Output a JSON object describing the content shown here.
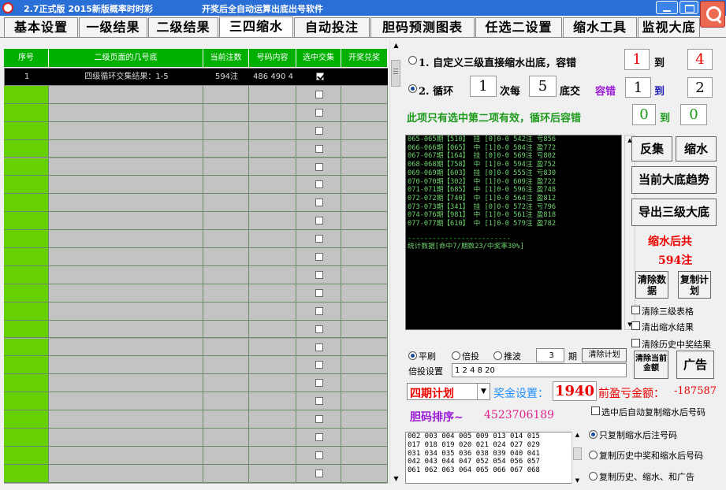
{
  "window": {
    "version": "2.7正式版 2015新版概率时时彩",
    "subtitle": "开奖后全自动运算出底出号软件"
  },
  "tabs": [
    "基本设置",
    "一级结果",
    "二级结果",
    "三四缩水",
    "自动投注",
    "胆码预测图表",
    "任选二设置",
    "缩水工具",
    "监视大底"
  ],
  "active_tab": "三四缩水",
  "grid": {
    "columns": [
      "序号",
      "二级页面的几号底",
      "当前注数",
      "号码内容",
      "选中交集",
      "开奖兑奖"
    ],
    "selected_row": {
      "index": "1",
      "name": "四级循环交集结果：1-5",
      "count": "594注",
      "numbers": "486 490 4",
      "checked": true
    },
    "empty_rows": 22
  },
  "options": {
    "opt1_label": "1. 自定义三级直接缩水出底，容错",
    "opt1_from": "1",
    "opt1_to_label": "到",
    "opt1_to": "4",
    "opt2_label": "2. 循环",
    "opt2_times": "1",
    "opt2_every_label": "次每",
    "opt2_every": "5",
    "opt2_unit_label": "底交",
    "opt2_tol_label": "容错",
    "opt2_from": "1",
    "opt2_to_label": "到",
    "opt2_to": "2",
    "note": "此项只有选中第二项有效，循环后容错",
    "note_from": "0",
    "note_to_label": "到",
    "note_to": "0"
  },
  "console": {
    "lines": [
      "065-065期【510】 挂 [0]0-0 542注 亏856",
      "066-066期【065】 中 [1]0-0 584注 盈772",
      "067-067期【164】 挂 [0]0-0 569注 亏802",
      "068-068期【758】 中 [1]0-0 594注 盈752",
      "069-069期【603】 挂 [0]0-0 555注 亏830",
      "070-070期【302】 中 [1]0-0 609注 盈722",
      "071-071期【685】 中 [1]0-0 596注 盈748",
      "072-072期【740】 中 [1]0-0 564注 盈812",
      "073-073期【341】 挂 [0]0-0 572注 亏796",
      "074-076期【981】 中 [1]0-0 561注 盈818",
      "077-077期【610】 中 [1]0-0 579注 盈782"
    ],
    "separator": "-------------------------",
    "stats": "统计数据[命中7/期数23/中奖率30%]"
  },
  "buttons": {
    "invert": "反集",
    "shrink": "缩水",
    "trend": "当前大底趋势",
    "export": "导出三级大底",
    "clear_data": "清除数据",
    "copy_plan": "复制计划",
    "clear_amount": "清除当前金额",
    "ads": "广告",
    "clear_plan": "清除计划"
  },
  "result": {
    "label": "缩水后共",
    "count": "594注"
  },
  "checks": {
    "clear_table": "清除三级表格",
    "clear_result": "清出缩水结果",
    "clear_history": "清除历史中奖结果",
    "auto_copy": "选中后自动复制缩水后号码"
  },
  "betting": {
    "mode_flat": "平刷",
    "mode_multiple": "倍投",
    "mode_push": "推波",
    "periods_value": "3",
    "periods_label": "期",
    "multiple_label": "倍投设置",
    "multiple_value": "1 2 4 8 20"
  },
  "plan": {
    "selected": "四期计划",
    "prize_label": "奖金设置：",
    "prize_value": "1940",
    "profit_label": "前盈亏金额：",
    "profit_value": "-187587"
  },
  "dan": {
    "label": "胆码排序~",
    "value": "4523706189"
  },
  "numbers_list": [
    "002 003 004 005 009 013 014 015",
    "017 018 019 020 021 024 027 029",
    "031 034 035 036 038 039 040 041",
    "042 043 044 047 052 054 056 057",
    "061 062 063 064 065 066 067 068"
  ],
  "copy_modes": {
    "only_shrunk": "只复制缩水后注号码",
    "history_and_shrunk": "复制历史中奖和缩水后号码",
    "history_shrunk_ads": "复制历史、缩水、和广告"
  },
  "colors": {
    "grid_header": "#00b000",
    "row_index": "#66d100",
    "console_text": "#6fd36f",
    "accent_red": "#e00000",
    "accent_blue": "#1e90ff",
    "dan_value": "#e0208a"
  }
}
